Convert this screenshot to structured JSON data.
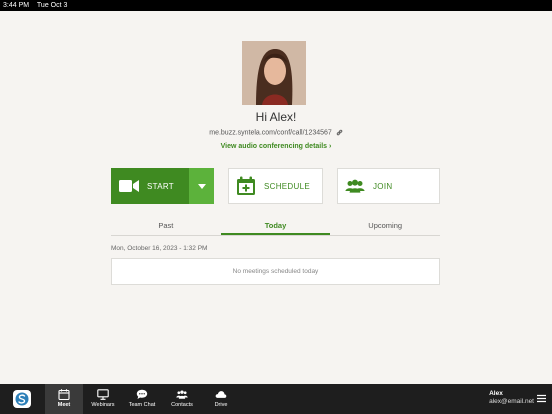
{
  "status_bar": {
    "time": "3:44 PM",
    "date": "Tue Oct 3"
  },
  "profile": {
    "greeting": "Hi Alex!",
    "meeting_url": "me.buzz.syntela.com/conf/call/1234567",
    "audio_details_link": "View audio conferencing details"
  },
  "actions": {
    "start": "START",
    "schedule": "SCHEDULE",
    "join": "JOIN"
  },
  "tabs": {
    "past": "Past",
    "today": "Today",
    "upcoming": "Upcoming",
    "active": "Today"
  },
  "meetings": {
    "date_header": "Mon, October 16, 2023 - 1:32 PM",
    "empty_message": "No meetings scheduled today"
  },
  "bottom_nav": {
    "items": [
      {
        "label": "Meet",
        "icon": "calendar-icon"
      },
      {
        "label": "Webinars",
        "icon": "monitor-icon"
      },
      {
        "label": "Team Chat",
        "icon": "chat-bubble-icon"
      },
      {
        "label": "Contacts",
        "icon": "people-icon"
      },
      {
        "label": "Drive",
        "icon": "cloud-icon"
      }
    ],
    "active": "Meet"
  },
  "user": {
    "name": "Alex",
    "email": "alex@email.net"
  },
  "colors": {
    "accent": "#3f8a21",
    "accent_light": "#5cb23b",
    "background": "#f6f4f1",
    "bottom_bar": "#1e1e1e"
  }
}
